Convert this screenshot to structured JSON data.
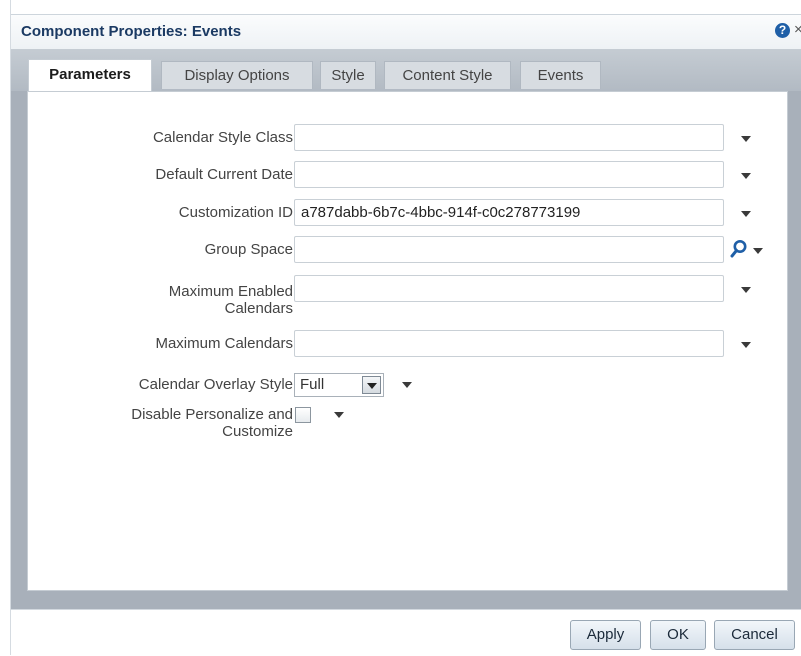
{
  "dialog": {
    "title": "Component Properties: Events",
    "help_icon": "?",
    "close_icon": "×"
  },
  "tabs": [
    {
      "label": "Parameters",
      "active": true
    },
    {
      "label": "Display Options",
      "active": false
    },
    {
      "label": "Style",
      "active": false
    },
    {
      "label": "Content Style",
      "active": false
    },
    {
      "label": "Events",
      "active": false
    }
  ],
  "params": {
    "calendar_style_class": {
      "label": "Calendar Style Class",
      "value": ""
    },
    "default_current_date": {
      "label": "Default Current Date",
      "value": ""
    },
    "customization_id": {
      "label": "Customization ID",
      "value": "a787dabb-6b7c-4bbc-914f-c0c278773199"
    },
    "group_space": {
      "label": "Group Space",
      "value": ""
    },
    "maximum_enabled_calendars": {
      "label_line1": "Maximum Enabled",
      "label_line2": "Calendars",
      "value": ""
    },
    "maximum_calendars": {
      "label": "Maximum Calendars",
      "value": ""
    },
    "calendar_overlay_style": {
      "label": "Calendar Overlay Style",
      "value": "Full"
    },
    "disable_personalize": {
      "label_line1": "Disable Personalize and",
      "label_line2": "Customize",
      "checked": false
    }
  },
  "buttons": {
    "apply": "Apply",
    "ok": "OK",
    "cancel": "Cancel"
  },
  "icons": {
    "search": "search-icon",
    "dropdown": "chevron-down-icon"
  },
  "colors": {
    "title_text": "#1b3a63",
    "search_icon": "#1f5fa7"
  }
}
